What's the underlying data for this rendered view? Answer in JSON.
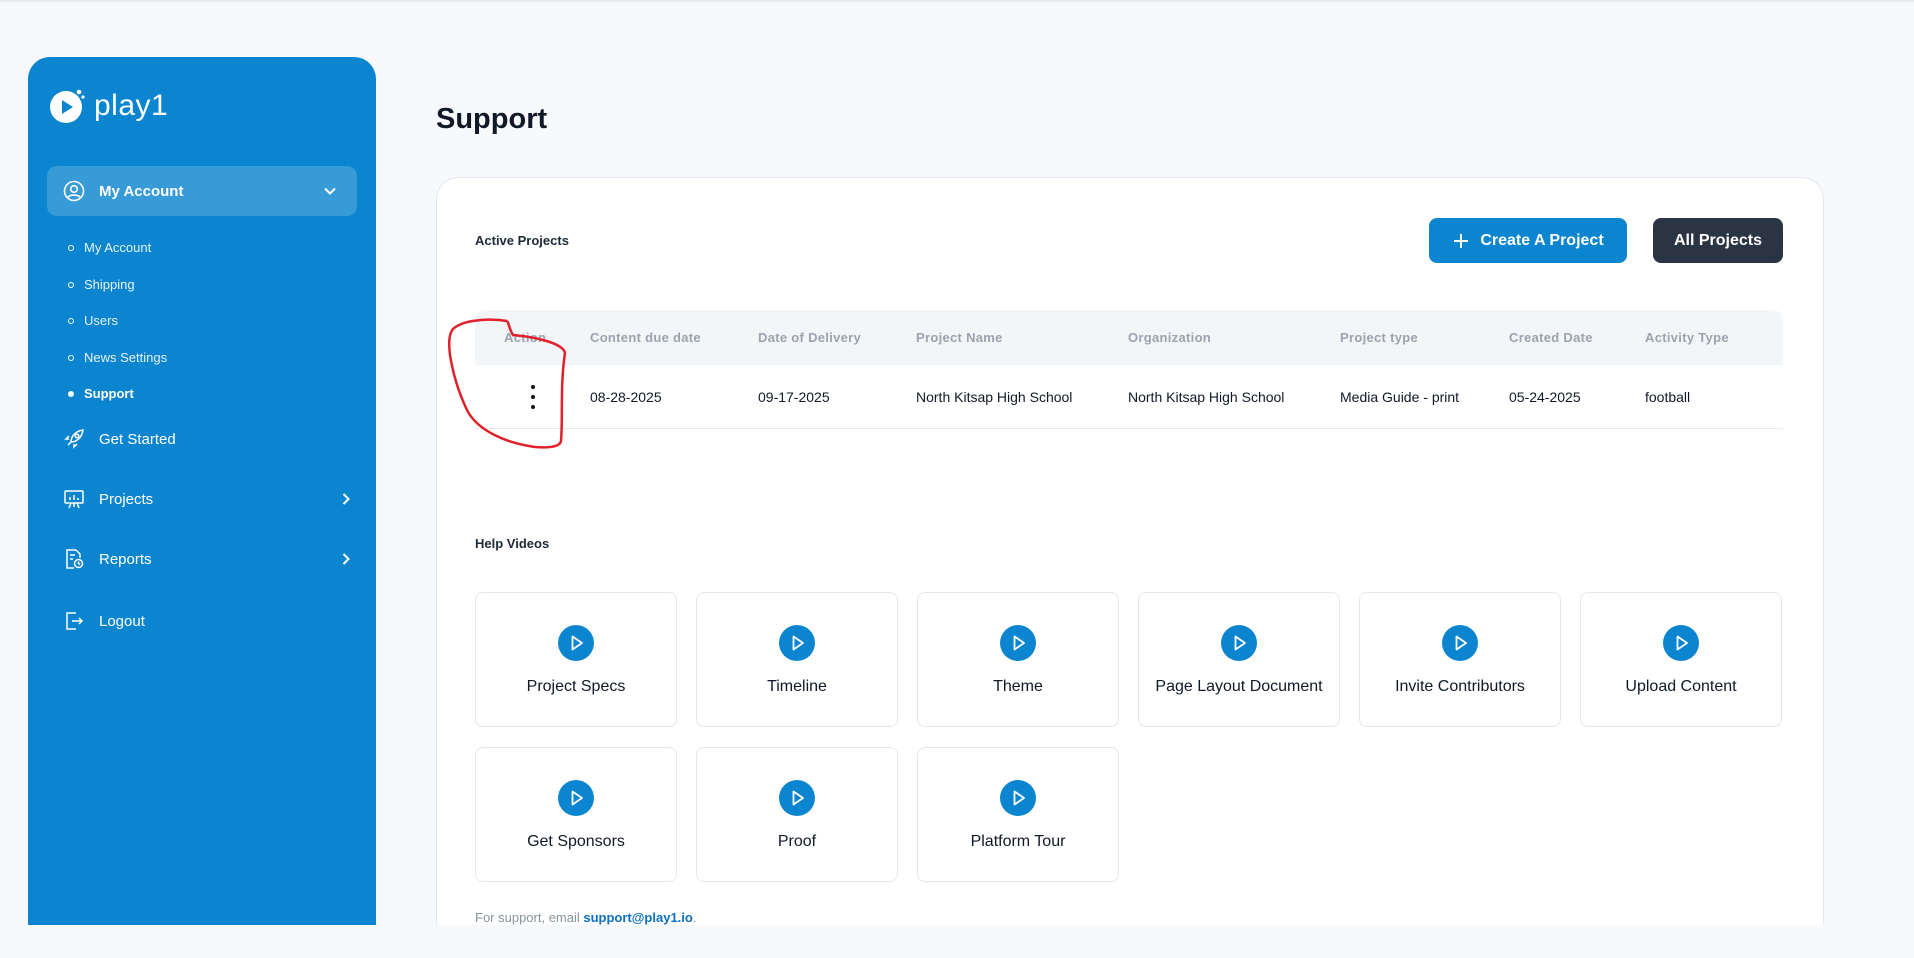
{
  "brand": {
    "name": "play1"
  },
  "sidebar": {
    "main_item": {
      "label": "My Account"
    },
    "sub_items": [
      {
        "label": "My Account"
      },
      {
        "label": "Shipping"
      },
      {
        "label": "Users"
      },
      {
        "label": "News Settings"
      },
      {
        "label": "Support"
      }
    ],
    "items": [
      {
        "label": "Get Started"
      },
      {
        "label": "Projects"
      },
      {
        "label": "Reports"
      },
      {
        "label": "Logout"
      }
    ]
  },
  "page": {
    "title": "Support"
  },
  "active_projects": {
    "title": "Active Projects",
    "create_label": "Create A Project",
    "all_label": "All Projects",
    "columns": [
      "Action",
      "Content due date",
      "Date of Delivery",
      "Project Name",
      "Organization",
      "Project type",
      "Created Date",
      "Activity Type"
    ],
    "rows": [
      {
        "content_due": "08-28-2025",
        "delivery": "09-17-2025",
        "project_name": "North Kitsap High School",
        "organization": "North Kitsap High School",
        "project_type": "Media Guide - print",
        "created": "05-24-2025",
        "activity": "football"
      }
    ]
  },
  "help_videos": {
    "title": "Help Videos",
    "items": [
      "Project Specs",
      "Timeline",
      "Theme",
      "Page Layout Document",
      "Invite Contributors",
      "Upload Content",
      "Get Sponsors",
      "Proof",
      "Platform Tour"
    ]
  },
  "support": {
    "prefix": "For support, email ",
    "email": "support@play1.io",
    "suffix": "."
  },
  "colors": {
    "brand_blue": "#0b85cf",
    "dark_button": "#2a3443",
    "annotation_red": "#e0202a"
  }
}
